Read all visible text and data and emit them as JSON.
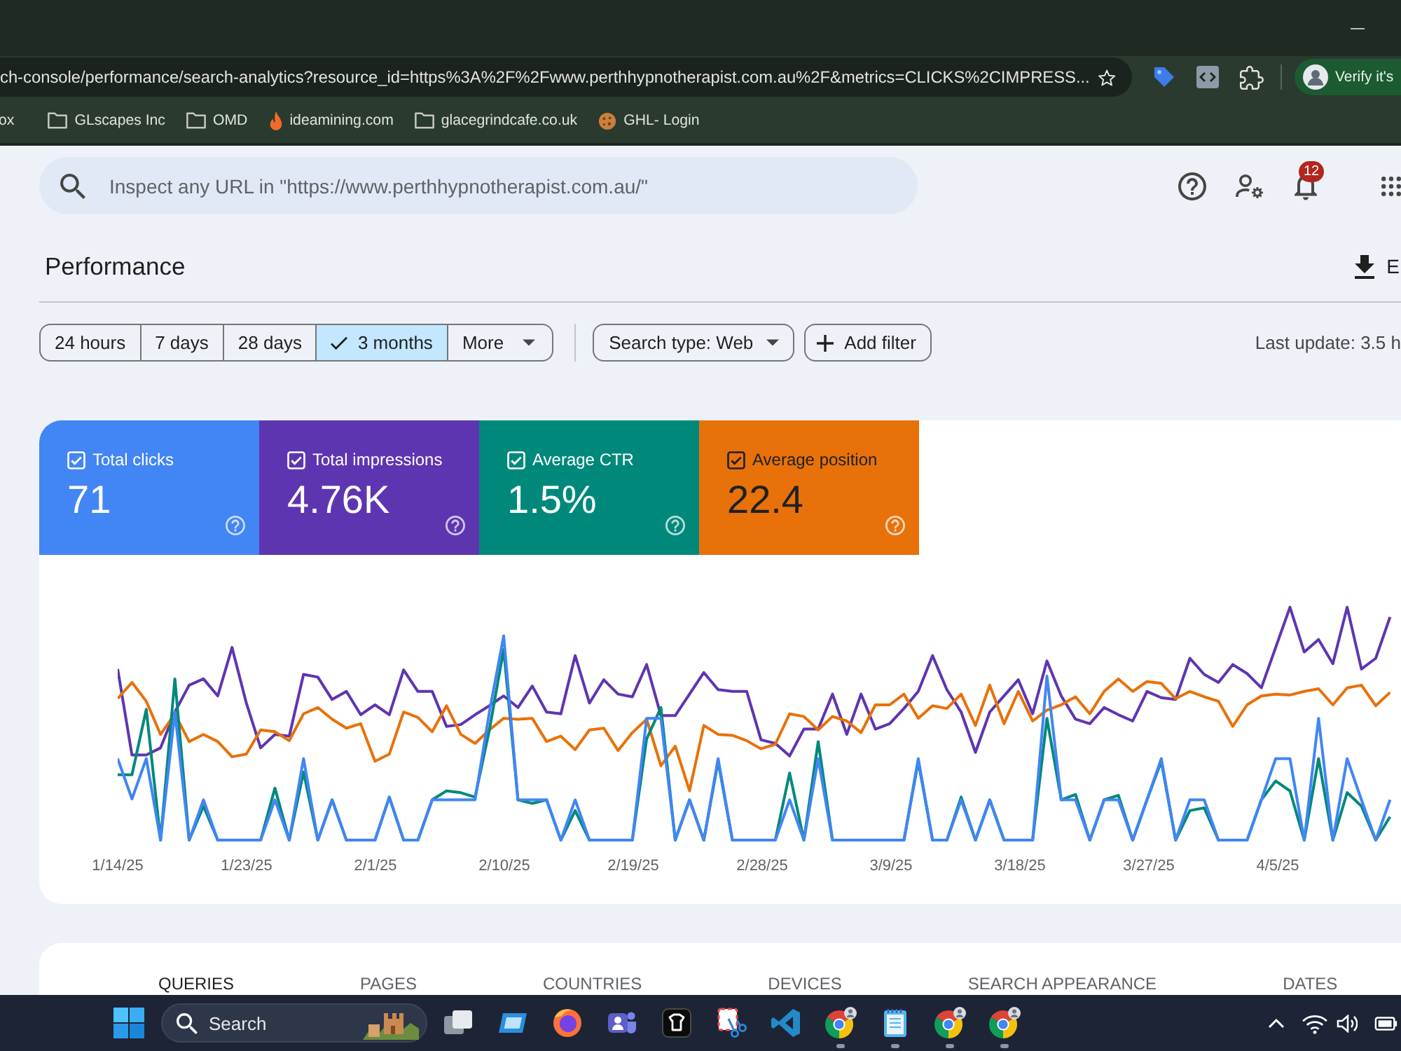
{
  "browser": {
    "address": "ch-console/performance/search-analytics?resource_id=https%3A%2F%2Fwww.perthhypnotherapist.com.au%2F&metrics=CLICKS%2CIMPRESS...",
    "profile_label": "Verify it's",
    "bookmarks": [
      {
        "label": "ox",
        "kind": "plain"
      },
      {
        "label": "GLscapes Inc",
        "kind": "folder"
      },
      {
        "label": "OMD",
        "kind": "folder"
      },
      {
        "label": "ideamining.com",
        "kind": "flame"
      },
      {
        "label": "glacegrindcafe.co.uk",
        "kind": "folder"
      },
      {
        "label": "GHL- Login",
        "kind": "cookie"
      }
    ]
  },
  "header": {
    "search": {
      "placeholder": "Inspect any URL in \"https://www.perthhypnotherapist.com.au/\""
    },
    "notification_count": "12"
  },
  "title_bar": {
    "title": "Performance",
    "export_label": "E"
  },
  "filters": {
    "ranges": [
      {
        "label": "24 hours",
        "selected": false
      },
      {
        "label": "7 days",
        "selected": false
      },
      {
        "label": "28 days",
        "selected": false
      },
      {
        "label": "3 months",
        "selected": true
      }
    ],
    "more": "More",
    "search_type": "Search type: Web",
    "add_filter": "Add filter",
    "last_update": "Last update: 3.5 h"
  },
  "metrics": [
    {
      "label": "Total clicks",
      "value": "71",
      "checked": true,
      "color": "#4285f4"
    },
    {
      "label": "Total impressions",
      "value": "4.76K",
      "checked": true,
      "color": "#5e35b1"
    },
    {
      "label": "Average CTR",
      "value": "1.5%",
      "checked": true,
      "color": "#00897b"
    },
    {
      "label": "Average position",
      "value": "22.4",
      "checked": true,
      "color": "#e8710a"
    }
  ],
  "chart": {
    "x_labels": [
      "1/14/25",
      "1/23/25",
      "2/1/25",
      "2/10/25",
      "2/19/25",
      "2/28/25",
      "3/9/25",
      "3/18/25",
      "3/27/25",
      "4/5/25"
    ]
  },
  "report_tabs": [
    {
      "label": "QUERIES",
      "selected": true
    },
    {
      "label": "PAGES",
      "selected": false
    },
    {
      "label": "COUNTRIES",
      "selected": false
    },
    {
      "label": "DEVICES",
      "selected": false
    },
    {
      "label": "SEARCH APPEARANCE",
      "selected": false
    },
    {
      "label": "DATES",
      "selected": false
    }
  ],
  "taskbar": {
    "search_label": "Search",
    "apps": [
      {
        "kind": "stack",
        "running": false
      },
      {
        "kind": "window",
        "running": false
      },
      {
        "kind": "globe",
        "running": false
      },
      {
        "kind": "people",
        "running": false
      },
      {
        "kind": "tile",
        "running": false
      },
      {
        "kind": "scissors",
        "running": false
      },
      {
        "kind": "code",
        "running": false
      },
      {
        "kind": "profile-browser",
        "running": true
      },
      {
        "kind": "notepad",
        "running": true
      },
      {
        "kind": "profile-browser",
        "running": true
      },
      {
        "kind": "profile-browser",
        "running": true
      }
    ]
  }
}
